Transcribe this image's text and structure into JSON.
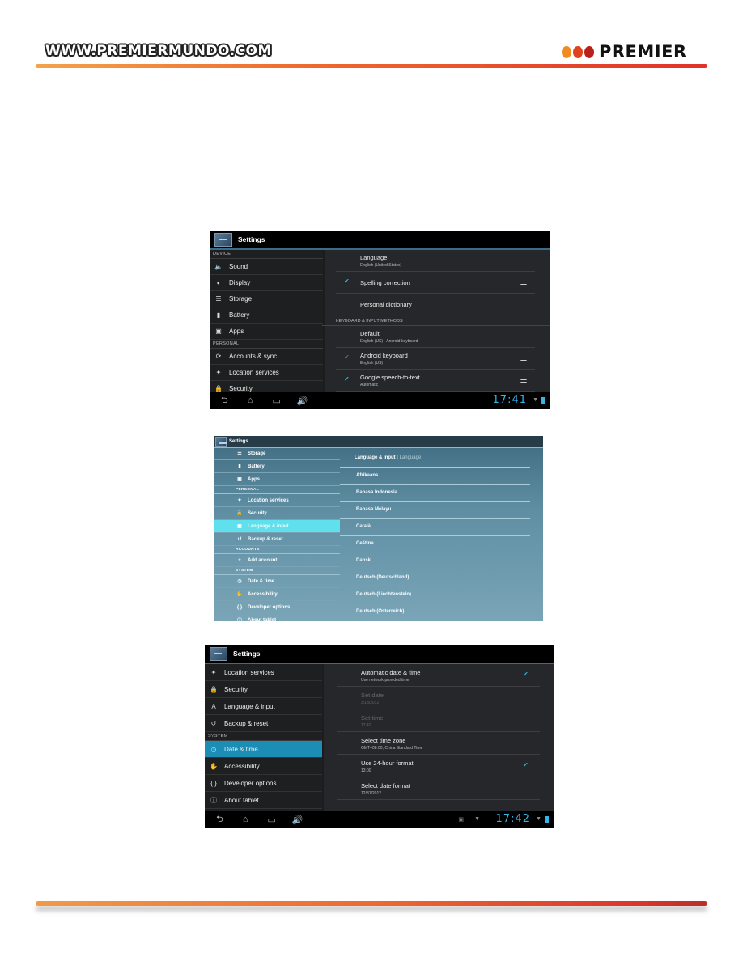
{
  "header": {
    "site_url": "WWW.PREMIERMUNDO.COM",
    "brand": "PREMIER",
    "brand_dot_colors": [
      "#f28a1d",
      "#e0421e",
      "#b8201a"
    ]
  },
  "screenshot1": {
    "title": "Settings",
    "sidebar": [
      {
        "type": "category",
        "label": "DEVICE"
      },
      {
        "type": "item",
        "icon": "speaker-icon",
        "glyph": "🔈",
        "label": "Sound"
      },
      {
        "type": "item",
        "icon": "display-icon",
        "glyph": "◐",
        "label": "Display"
      },
      {
        "type": "item",
        "icon": "storage-icon",
        "glyph": "☰",
        "label": "Storage"
      },
      {
        "type": "item",
        "icon": "battery-icon",
        "glyph": "▮",
        "label": "Battery"
      },
      {
        "type": "item",
        "icon": "apps-icon",
        "glyph": "▣",
        "label": "Apps"
      },
      {
        "type": "category",
        "label": "PERSONAL"
      },
      {
        "type": "item",
        "icon": "sync-icon",
        "glyph": "⟳",
        "label": "Accounts & sync"
      },
      {
        "type": "item",
        "icon": "location-icon",
        "glyph": "✦",
        "label": "Location services"
      },
      {
        "type": "item",
        "icon": "lock-icon",
        "glyph": "🔒",
        "label": "Security"
      }
    ],
    "prefs": [
      {
        "title": "Language",
        "summary": "English (United States)",
        "check": null,
        "settings_button": false
      },
      {
        "title": "Spelling correction",
        "summary": "",
        "check": "on",
        "settings_button": true
      },
      {
        "title": "Personal dictionary",
        "summary": "",
        "check": null,
        "settings_button": false
      }
    ],
    "section_header": "KEYBOARD & INPUT METHODS",
    "input_methods": [
      {
        "title": "Default",
        "summary": "English (US) - Android keyboard",
        "check": null,
        "settings_button": false
      },
      {
        "title": "Android keyboard",
        "summary": "English (US)",
        "check": "dim",
        "settings_button": true
      },
      {
        "title": "Google speech-to-text",
        "summary": "Automatic",
        "check": "on",
        "settings_button": true
      }
    ],
    "clock": "17:41"
  },
  "screenshot2": {
    "title": "Settings",
    "sidebar": [
      {
        "type": "item",
        "icon": "storage-icon",
        "glyph": "☰",
        "label": "Storage"
      },
      {
        "type": "item",
        "icon": "battery-icon",
        "glyph": "▮",
        "label": "Battery"
      },
      {
        "type": "item",
        "icon": "apps-icon",
        "glyph": "▣",
        "label": "Apps"
      },
      {
        "type": "category",
        "label": "PERSONAL"
      },
      {
        "type": "item",
        "icon": "location-icon",
        "glyph": "✦",
        "label": "Location services"
      },
      {
        "type": "item",
        "icon": "lock-icon",
        "glyph": "🔒",
        "label": "Security"
      },
      {
        "type": "item",
        "icon": "language-icon",
        "glyph": "▣",
        "label": "Language & input",
        "active": true
      },
      {
        "type": "item",
        "icon": "backup-icon",
        "glyph": "↺",
        "label": "Backup & reset"
      },
      {
        "type": "category",
        "label": "ACCOUNTS"
      },
      {
        "type": "item",
        "icon": "add-icon",
        "glyph": "+",
        "label": "Add account"
      },
      {
        "type": "category",
        "label": "SYSTEM"
      },
      {
        "type": "item",
        "icon": "clock-icon",
        "glyph": "◷",
        "label": "Date & time"
      },
      {
        "type": "item",
        "icon": "accessibility-icon",
        "glyph": "✋",
        "label": "Accessibility"
      },
      {
        "type": "item",
        "icon": "developer-icon",
        "glyph": "{ }",
        "label": "Developer options"
      },
      {
        "type": "item",
        "icon": "info-icon",
        "glyph": "ⓘ",
        "label": "About tablet"
      }
    ],
    "breadcrumb": {
      "parent": "Language & input",
      "separator": " | ",
      "current": "Language"
    },
    "languages": [
      "Afrikaans",
      "Bahasa Indonesia",
      "Bahasa Melayu",
      "Català",
      "Čeština",
      "Dansk",
      "Deutsch (Deutschland)",
      "Deutsch (Liechtenstein)",
      "Deutsch (Österreich)"
    ]
  },
  "screenshot3": {
    "title": "Settings",
    "sidebar": [
      {
        "type": "item",
        "icon": "location-icon",
        "glyph": "✦",
        "label": "Location services"
      },
      {
        "type": "item",
        "icon": "lock-icon",
        "glyph": "🔒",
        "label": "Security"
      },
      {
        "type": "item",
        "icon": "language-icon",
        "glyph": "A",
        "label": "Language & input"
      },
      {
        "type": "item",
        "icon": "backup-icon",
        "glyph": "↺",
        "label": "Backup & reset"
      },
      {
        "type": "category",
        "label": "SYSTEM"
      },
      {
        "type": "item",
        "icon": "clock-icon",
        "glyph": "◷",
        "label": "Date & time",
        "active": true
      },
      {
        "type": "item",
        "icon": "accessibility-icon",
        "glyph": "✋",
        "label": "Accessibility"
      },
      {
        "type": "item",
        "icon": "developer-icon",
        "glyph": "{ }",
        "label": "Developer options"
      },
      {
        "type": "item",
        "icon": "info-icon",
        "glyph": "ⓘ",
        "label": "About tablet"
      }
    ],
    "prefs": [
      {
        "title": "Automatic date & time",
        "summary": "Use network-provided time",
        "check": "on",
        "disabled": false
      },
      {
        "title": "Set date",
        "summary": "3/13/2012",
        "check": null,
        "disabled": true
      },
      {
        "title": "Set time",
        "summary": "17:42",
        "check": null,
        "disabled": true
      },
      {
        "title": "Select time zone",
        "summary": "GMT+08:00, China Standard Time",
        "check": null,
        "disabled": false
      },
      {
        "title": "Use 24-hour format",
        "summary": "13:00",
        "check": "on",
        "disabled": false
      },
      {
        "title": "Select date format",
        "summary": "12/31/2012",
        "check": null,
        "disabled": false
      }
    ],
    "clock": "17:42"
  },
  "navbar": {
    "back": "⮌",
    "home": "⌂",
    "recents": "▭",
    "volume": "🔊",
    "accent": "#33b5e5"
  }
}
